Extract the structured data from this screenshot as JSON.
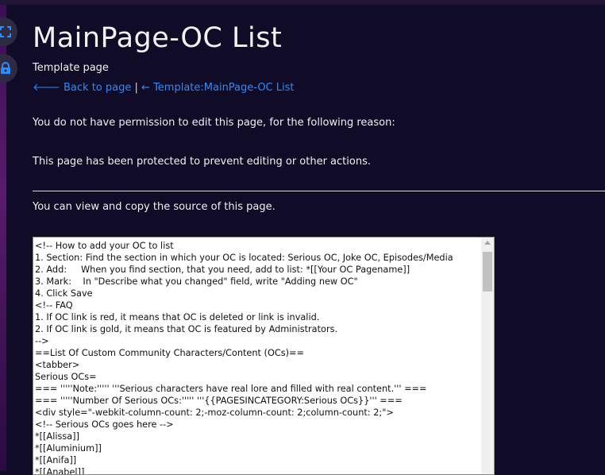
{
  "page": {
    "title": "MainPage-OC List",
    "subtitle": "Template page",
    "back_link": "Back to page",
    "separator": "|",
    "template_link": "← Template:MainPage-OC List",
    "permission_text": "You do not have permission to edit this page, for the following reason:",
    "protected_text": "This page has been protected to prevent editing or other actions.",
    "view_source_text": "You can view and copy the source of this page."
  },
  "side_buttons": [
    {
      "icon": "fullscreen-icon"
    },
    {
      "icon": "lock-icon"
    }
  ],
  "source_lines": [
    "<!-- How to add your OC to list",
    "1. Section: Find the section in which your OC is located: Serious OC, Joke OC, Episodes/Media",
    "2. Add:     When you find section, that you need, add to list: *[[Your OC Pagename]]",
    "3. Mark:    In \"Describe what you changed\" field, write \"Adding new OC\"",
    "4. Click Save",
    "<!-- FAQ",
    "1. If OC link is red, it means that OC is deleted or link is invalid.",
    "2. If OC link is gold, it means that OC is featured by Administrators.",
    "-->",
    "==List Of Custom Community Characters/Content (OCs)==",
    "<tabber>",
    "Serious OCs=",
    "=== '''''Note:''''' '''Serious characters have real lore and filled with real content.''' ===",
    "=== '''''Number Of Serious OCs:''''' '''{{PAGESINCATEGORY:Serious OCs}}''' ===",
    "<div style=\"-webkit-column-count: 2;-moz-column-count: 2;column-count: 2;\">",
    "<!-- Serious OCs goes here -->",
    "*[[Alissa]]",
    "*[[Aluminium]]",
    "*[[Anifa]]",
    "*[[Anabel]]"
  ],
  "colors": {
    "background": "#100b26",
    "link": "#2a8cff"
  }
}
